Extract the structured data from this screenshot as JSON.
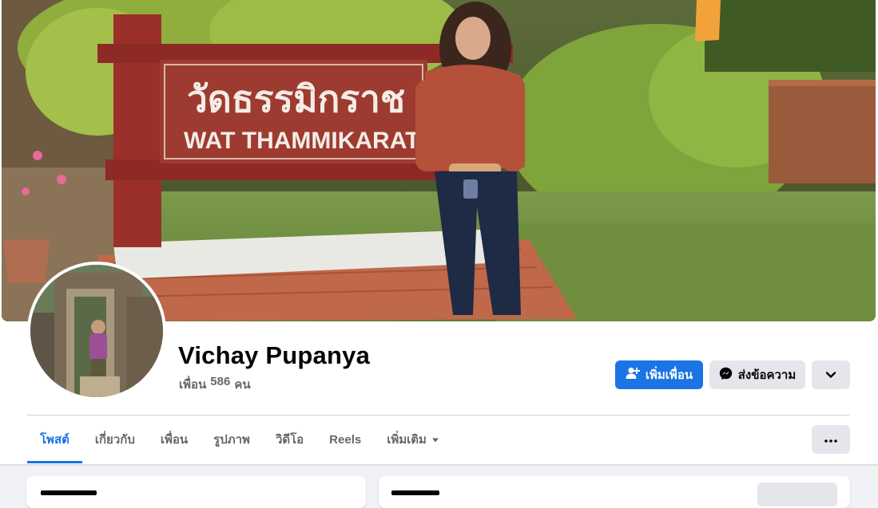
{
  "profile": {
    "name": "Vichay Pupanya",
    "friends_label": "เพื่อน",
    "friends_count": "586",
    "friends_unit": "คน"
  },
  "cover": {
    "sign_thai": "วัดธรรมิกราช",
    "sign_english": "WAT THAMMIKARAT"
  },
  "actions": {
    "add_friend_label": "เพิ่มเพื่อน",
    "message_label": "ส่งข้อความ",
    "add_friend_icon": "add-user-icon",
    "message_icon": "messenger-icon",
    "more_icon": "chevron-down-icon"
  },
  "tabs": [
    {
      "label": "โพสต์",
      "active": true
    },
    {
      "label": "เกี่ยวกับ",
      "active": false
    },
    {
      "label": "เพื่อน",
      "active": false
    },
    {
      "label": "รูปภาพ",
      "active": false
    },
    {
      "label": "วิดีโอ",
      "active": false
    },
    {
      "label": "Reels",
      "active": false
    },
    {
      "label": "เพิ่มเติม",
      "active": false
    }
  ],
  "colors": {
    "accent": "#1b74e4",
    "secondary_button": "#e4e6eb",
    "text_primary": "#050505",
    "text_secondary": "#65676b",
    "background": "#f0f2f5"
  }
}
